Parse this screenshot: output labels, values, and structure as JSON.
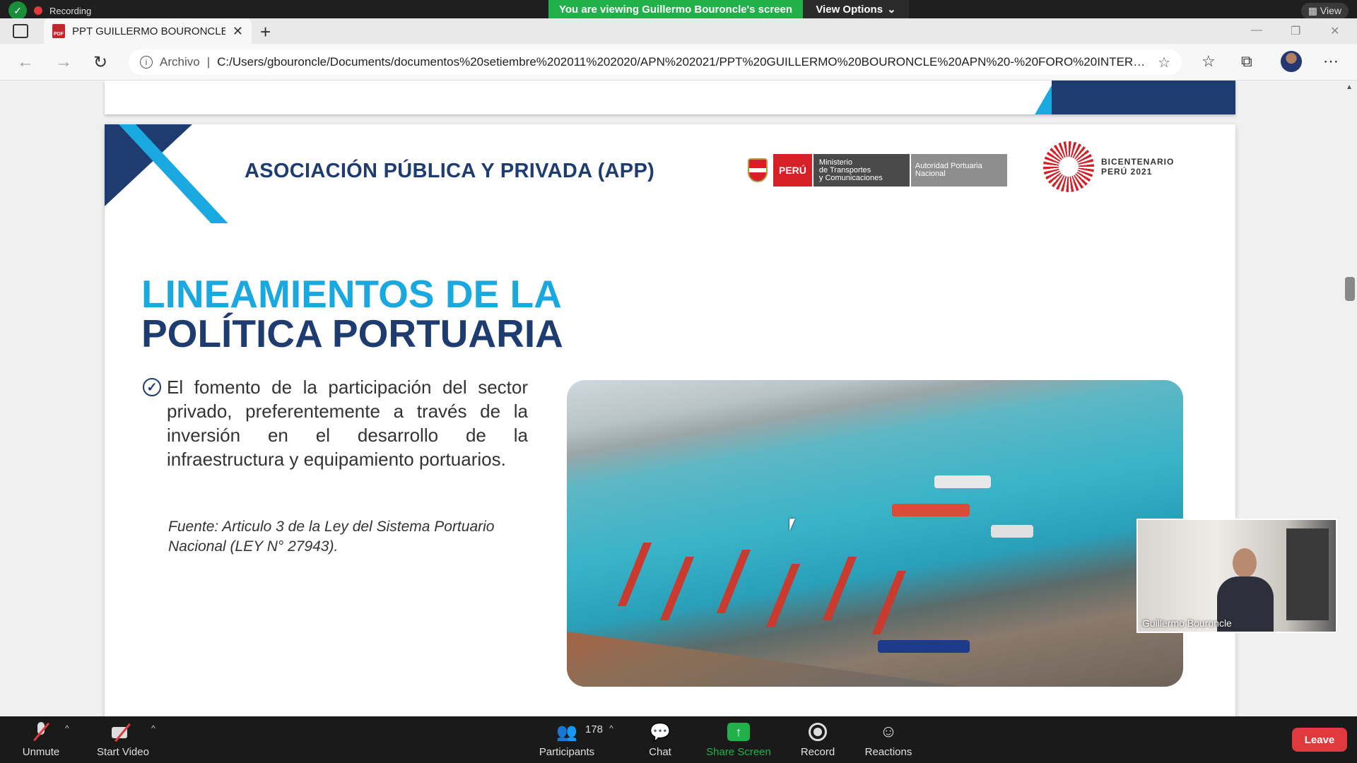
{
  "zoom": {
    "recording_label": "Recording",
    "share_banner": "You are viewing Guillermo Bouroncle's screen",
    "view_options": "View Options",
    "view_label": "View"
  },
  "browser": {
    "tab_title": "PPT GUILLERMO BOURONCLE A",
    "pdf_icon_text": "PDF",
    "address_prefix": "Archivo",
    "url": "C:/Users/gbouroncle/Documents/documentos%20setiembre%202011%202020/APN%202021/PPT%20GUILLERMO%20BOURONCLE%20APN%20-%20FORO%20INTERN..."
  },
  "slide": {
    "header_title": "ASOCIACIÓN PÚBLICA Y PRIVADA (APP)",
    "peru_label": "PERÚ",
    "mtc_line1": "Ministerio",
    "mtc_line2": "de Transportes",
    "mtc_line3": "y Comunicaciones",
    "apn_line1": "Autoridad Portuaria",
    "apn_line2": "Nacional",
    "bicentenario_line1": "BICENTENARIO",
    "bicentenario_line2": "PERÚ 2021",
    "title_line1": "LINEAMIENTOS DE LA",
    "title_line2": "POLÍTICA PORTUARIA",
    "bullet": "El fomento de la participación del sector privado, preferentemente a través de la inversión en el desarrollo de la infraestructura y equipamiento portuarios.",
    "source": "Fuente: Articulo 3 de la Ley del Sistema Portuario Nacional (LEY N° 27943)."
  },
  "speaker": {
    "name": "Guillermo Bouroncle"
  },
  "toolbar": {
    "unmute": "Unmute",
    "start_video": "Start Video",
    "participants": "Participants",
    "participant_count": "178",
    "chat": "Chat",
    "share_screen": "Share Screen",
    "record": "Record",
    "reactions": "Reactions",
    "leave": "Leave"
  },
  "colors": {
    "brand_navy": "#1f3c70",
    "brand_cyan": "#1aa8e0",
    "zoom_green": "#21b14b",
    "leave_red": "#e0393e"
  }
}
